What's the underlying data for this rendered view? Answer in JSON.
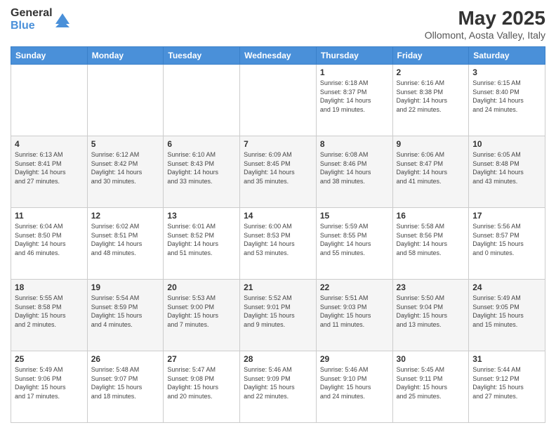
{
  "logo": {
    "general": "General",
    "blue": "Blue"
  },
  "title": "May 2025",
  "location": "Ollomont, Aosta Valley, Italy",
  "days_of_week": [
    "Sunday",
    "Monday",
    "Tuesday",
    "Wednesday",
    "Thursday",
    "Friday",
    "Saturday"
  ],
  "weeks": [
    [
      {
        "day": "",
        "info": ""
      },
      {
        "day": "",
        "info": ""
      },
      {
        "day": "",
        "info": ""
      },
      {
        "day": "",
        "info": ""
      },
      {
        "day": "1",
        "info": "Sunrise: 6:18 AM\nSunset: 8:37 PM\nDaylight: 14 hours\nand 19 minutes."
      },
      {
        "day": "2",
        "info": "Sunrise: 6:16 AM\nSunset: 8:38 PM\nDaylight: 14 hours\nand 22 minutes."
      },
      {
        "day": "3",
        "info": "Sunrise: 6:15 AM\nSunset: 8:40 PM\nDaylight: 14 hours\nand 24 minutes."
      }
    ],
    [
      {
        "day": "4",
        "info": "Sunrise: 6:13 AM\nSunset: 8:41 PM\nDaylight: 14 hours\nand 27 minutes."
      },
      {
        "day": "5",
        "info": "Sunrise: 6:12 AM\nSunset: 8:42 PM\nDaylight: 14 hours\nand 30 minutes."
      },
      {
        "day": "6",
        "info": "Sunrise: 6:10 AM\nSunset: 8:43 PM\nDaylight: 14 hours\nand 33 minutes."
      },
      {
        "day": "7",
        "info": "Sunrise: 6:09 AM\nSunset: 8:45 PM\nDaylight: 14 hours\nand 35 minutes."
      },
      {
        "day": "8",
        "info": "Sunrise: 6:08 AM\nSunset: 8:46 PM\nDaylight: 14 hours\nand 38 minutes."
      },
      {
        "day": "9",
        "info": "Sunrise: 6:06 AM\nSunset: 8:47 PM\nDaylight: 14 hours\nand 41 minutes."
      },
      {
        "day": "10",
        "info": "Sunrise: 6:05 AM\nSunset: 8:48 PM\nDaylight: 14 hours\nand 43 minutes."
      }
    ],
    [
      {
        "day": "11",
        "info": "Sunrise: 6:04 AM\nSunset: 8:50 PM\nDaylight: 14 hours\nand 46 minutes."
      },
      {
        "day": "12",
        "info": "Sunrise: 6:02 AM\nSunset: 8:51 PM\nDaylight: 14 hours\nand 48 minutes."
      },
      {
        "day": "13",
        "info": "Sunrise: 6:01 AM\nSunset: 8:52 PM\nDaylight: 14 hours\nand 51 minutes."
      },
      {
        "day": "14",
        "info": "Sunrise: 6:00 AM\nSunset: 8:53 PM\nDaylight: 14 hours\nand 53 minutes."
      },
      {
        "day": "15",
        "info": "Sunrise: 5:59 AM\nSunset: 8:55 PM\nDaylight: 14 hours\nand 55 minutes."
      },
      {
        "day": "16",
        "info": "Sunrise: 5:58 AM\nSunset: 8:56 PM\nDaylight: 14 hours\nand 58 minutes."
      },
      {
        "day": "17",
        "info": "Sunrise: 5:56 AM\nSunset: 8:57 PM\nDaylight: 15 hours\nand 0 minutes."
      }
    ],
    [
      {
        "day": "18",
        "info": "Sunrise: 5:55 AM\nSunset: 8:58 PM\nDaylight: 15 hours\nand 2 minutes."
      },
      {
        "day": "19",
        "info": "Sunrise: 5:54 AM\nSunset: 8:59 PM\nDaylight: 15 hours\nand 4 minutes."
      },
      {
        "day": "20",
        "info": "Sunrise: 5:53 AM\nSunset: 9:00 PM\nDaylight: 15 hours\nand 7 minutes."
      },
      {
        "day": "21",
        "info": "Sunrise: 5:52 AM\nSunset: 9:01 PM\nDaylight: 15 hours\nand 9 minutes."
      },
      {
        "day": "22",
        "info": "Sunrise: 5:51 AM\nSunset: 9:03 PM\nDaylight: 15 hours\nand 11 minutes."
      },
      {
        "day": "23",
        "info": "Sunrise: 5:50 AM\nSunset: 9:04 PM\nDaylight: 15 hours\nand 13 minutes."
      },
      {
        "day": "24",
        "info": "Sunrise: 5:49 AM\nSunset: 9:05 PM\nDaylight: 15 hours\nand 15 minutes."
      }
    ],
    [
      {
        "day": "25",
        "info": "Sunrise: 5:49 AM\nSunset: 9:06 PM\nDaylight: 15 hours\nand 17 minutes."
      },
      {
        "day": "26",
        "info": "Sunrise: 5:48 AM\nSunset: 9:07 PM\nDaylight: 15 hours\nand 18 minutes."
      },
      {
        "day": "27",
        "info": "Sunrise: 5:47 AM\nSunset: 9:08 PM\nDaylight: 15 hours\nand 20 minutes."
      },
      {
        "day": "28",
        "info": "Sunrise: 5:46 AM\nSunset: 9:09 PM\nDaylight: 15 hours\nand 22 minutes."
      },
      {
        "day": "29",
        "info": "Sunrise: 5:46 AM\nSunset: 9:10 PM\nDaylight: 15 hours\nand 24 minutes."
      },
      {
        "day": "30",
        "info": "Sunrise: 5:45 AM\nSunset: 9:11 PM\nDaylight: 15 hours\nand 25 minutes."
      },
      {
        "day": "31",
        "info": "Sunrise: 5:44 AM\nSunset: 9:12 PM\nDaylight: 15 hours\nand 27 minutes."
      }
    ]
  ]
}
